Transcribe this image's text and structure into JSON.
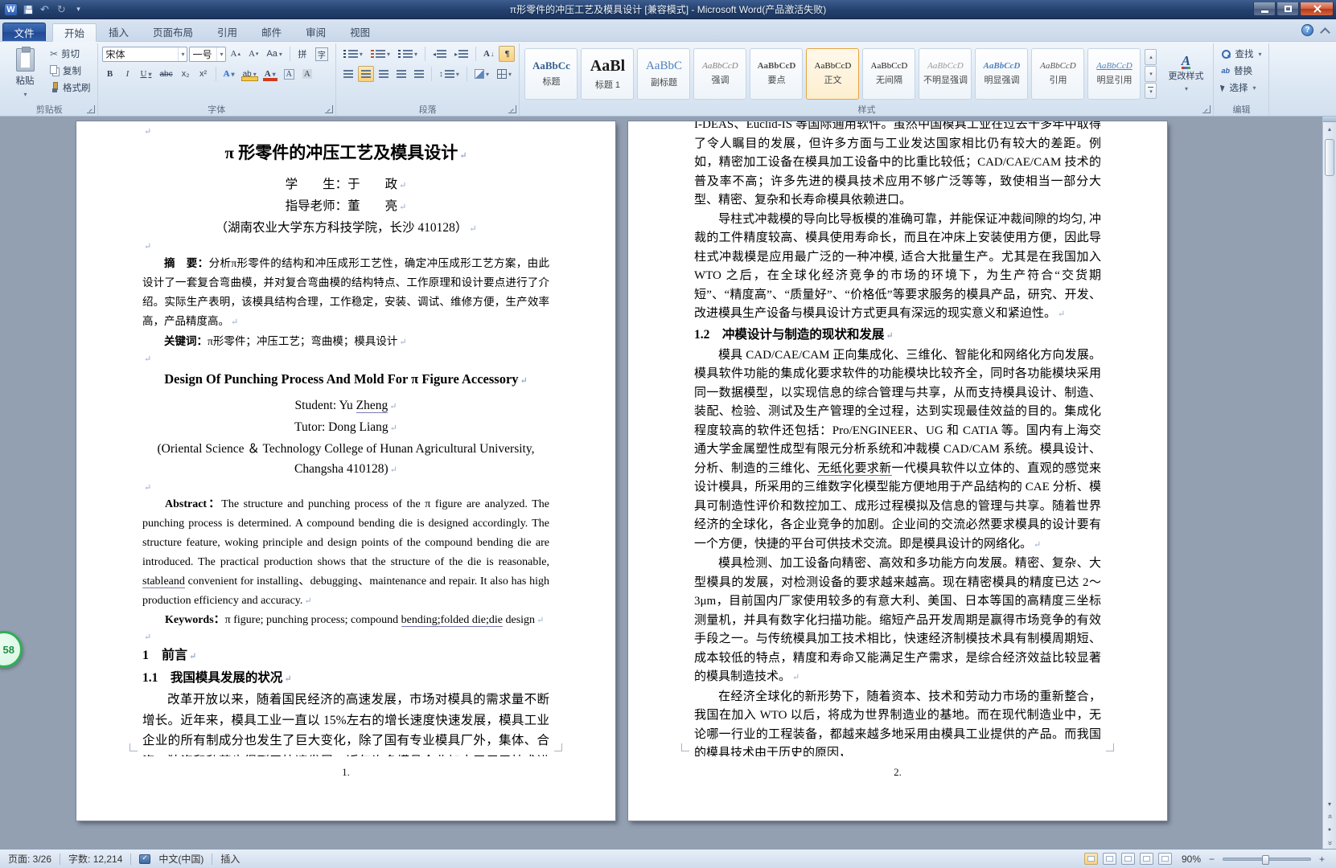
{
  "titlebar": {
    "title": "π形零件的冲压工艺及模具设计 [兼容模式] - Microsoft Word(产品激活失败)"
  },
  "ribbon": {
    "file_tab": "文件",
    "tabs": [
      "开始",
      "插入",
      "页面布局",
      "引用",
      "邮件",
      "审阅",
      "视图"
    ],
    "clipboard": {
      "label": "剪贴板",
      "paste": "粘贴",
      "cut": "剪切",
      "copy": "复制",
      "format_painter": "格式刷"
    },
    "font": {
      "label": "字体",
      "family": "宋体",
      "size": "一号",
      "bold": "B",
      "italic": "I",
      "underline": "U",
      "strike": "abc",
      "subscript": "x₂",
      "superscript": "x²",
      "grow": "A",
      "shrink": "A",
      "change_case": "Aa",
      "pinyin": "拼",
      "enclose": "字",
      "text_effect": "A",
      "highlight": "ab",
      "font_color": "A",
      "char_border": "A",
      "char_shade": "A"
    },
    "paragraph": {
      "label": "段落",
      "sort": "A",
      "pilcrow": "¶"
    },
    "styles": {
      "label": "样式",
      "change": "更改样式",
      "items": [
        {
          "preview": "AaBbCc",
          "name": "标题"
        },
        {
          "preview": "AaBl",
          "name": "标题 1"
        },
        {
          "preview": "AaBbC",
          "name": "副标题"
        },
        {
          "preview": "AaBbCcD",
          "name": "强调"
        },
        {
          "preview": "AaBbCcD",
          "name": "要点"
        },
        {
          "preview": "AaBbCcD",
          "name": "正文"
        },
        {
          "preview": "AaBbCcD",
          "name": "无间隔"
        },
        {
          "preview": "AaBbCcD",
          "name": "不明显强调"
        },
        {
          "preview": "AaBbCcD",
          "name": "明显强调"
        },
        {
          "preview": "AaBbCcD",
          "name": "引用"
        },
        {
          "preview": "AaBbCcD",
          "name": "明显引用"
        }
      ]
    },
    "editing": {
      "label": "编辑",
      "find": "查找",
      "replace": "替换",
      "select": "选择"
    }
  },
  "page1": {
    "title": "π 形零件的冲压工艺及模具设计",
    "student_line": "学　　生：于　　政",
    "tutor_line": "指导老师：董　　亮",
    "affiliation": "（湖南农业大学东方科技学院，长沙  410128）",
    "abstract_label": "摘　要：",
    "abstract_text": "分析π形零件的结构和冲压成形工艺性，确定冲压成形工艺方案，由此设计了一套复合弯曲模，并对复合弯曲模的结构特点、工作原理和设计要点进行了介绍。实际生产表明，该模具结构合理，工作稳定，安装、调试、维修方便，生产效率高，产品精度高。",
    "keywords_label": "关键词：",
    "keywords_text": "π形零件；冲压工艺；弯曲模；模具设计",
    "title_en": "Design Of Punching Process And Mold For  π Figure Accessory",
    "student_en_pre": "Student: Yu ",
    "student_en_name": "Zheng",
    "tutor_en": "Tutor: Dong Liang",
    "affiliation_en": "(Oriental Science ＆ Technology College of Hunan Agricultural University, Changsha 410128)",
    "abstract_en_label": "Abstract：",
    "abstract_en_p1": "The structure and punching process of the π figure are analyzed. The punching process is determined. A compound bending die is designed accordingly. The structure feature, woking principle and design points of the compound bending die are introduced. The practical production shows that the structure of the die is reasonable, ",
    "abstract_en_u": "stableand",
    "abstract_en_p2": " convenient for installing、debugging、maintenance and repair. It also has high production efficiency and accuracy.",
    "keywords_en_label": "Keywords：",
    "keywords_en_p1": "π figure; punching process; compound ",
    "keywords_en_u": "bending;folded die;die",
    "keywords_en_p2": " design",
    "heading_1": "1　前言",
    "heading_1_1": "1.1　我国模具发展的状况",
    "para1": "改革开放以来，随着国民经济的高速发展，市场对模具的需求量不断增长。近年来，模具工业一直以 15%左右的增长速度快速发展，模具工业企业的所有制成分也发生了巨大变化，除了国有专业模具厂外，集体、合资、独资和私营也得到了快速发展。近年许多模具企业加大了用于技术进步的投资力度，将技术进步视为企业发展的重要",
    "page_number": "1."
  },
  "page2": {
    "para1": "I-DEAS、Euclid-IS 等国际通用软件。虽然中国模具工业在过去十多年中取得了令人瞩目的发展，但许多方面与工业发达国家相比仍有较大的差距。例如，精密加工设备在模具加工设备中的比重比较低；CA​D/CAE/CAM 技术的普及率不高；许多先进的模具技术应用不够广泛等等，致使相当一部分大型、精密、复杂和长寿命模具依赖进口。",
    "para2": "导柱式冲裁模的导向比导板模的准确可靠，并能保证冲裁间隙的均匀, 冲裁的工件精度较高、模具使用寿命长，而且在冲床上安装使用方便，因此导柱式冲裁模是应用最广泛的一种冲模, 适合大批量生产。尤其是在我国加入 WTO 之后，在全球化经济竞争的市场的环境下，为生产符合“交货期短”、“精度高”、“质量好”、“价格低”等要求服务的模具产品，研究、开发、改进模具生产设备与模具设计方式更具有深远的现实意义和紧迫性。",
    "heading_1_2": "1.2　冲模设计与制造的现状和发展",
    "para3_p1": "模具 CAD/CAE/CAM 正向集成化、三维化、智能化和网络化方向发展。模具软件功能的集成化要求软件的功能模块比较齐全，同时各功能模块采用同一数据模型，以实现信息的综合管理与共享，从而支持模具设计、制造、装配、检验、测试及生产管理的全过程，达到实现最佳效益的目的。集成化程度较高的软件还包括：Pro/ENGINEER、UG 和 CATIA 等。国内有上海交通大学金属塑性成型有限元分析系统和冲裁模 CAD/CAM 系统。模具设计、分析、制造的三维化、",
    "para3_u": "无纸化要求新",
    "para3_p2": "一代模具软件以立体的、直观的感觉来设计模具，所采用的三维数字化模型能方便地用于产品结构的 CAE 分析、模具可制造性评价和数控加工、成形过程模拟及信息的管理与共享。随着世界经济的全球化，各企业竞争的加剧。企业间的交流必然要求模具的设计要有一个方便，快捷的平台可供技术交流。即是模具设计的网络化。",
    "para4": "模具检测、加工设备向精密、高效和多功能方向发展。精密、复杂、大型模具的发展，对检测设备的要求越来越高。现在精密模具的精度已达 2～3μm，目前国内厂家使用较多的有意大利、美国、日本等国的高精度三坐标测量机，并具有数字化扫描功能。缩短产品开发周期是赢得市场竞争的有效手段之一。与传统模具加工技术相比，快速经济制模技术具有制模周期短、成本较低的特点，精度和寿命又能满足生产需求，是综合经济效益比较显著的模具制造技术。",
    "para5": "在经济全球化的新形势下，随着资本、技术和劳动力市场的重新整合，我国在加入 WTO 以后，将成为世界制造业的基地。而在现代制造业中，无论哪一行业的工程装备，都越来越多地采用由模具工业提供的产品。而我国的模具技术由于历史的原因，",
    "page_number": "2."
  },
  "statusbar": {
    "page_info": "页面: 3/26",
    "word_count": "字数: 12,214",
    "language": "中文(中国)",
    "insert_mode": "插入",
    "zoom_level": "90%"
  },
  "floating_widget": {
    "label": "58"
  }
}
